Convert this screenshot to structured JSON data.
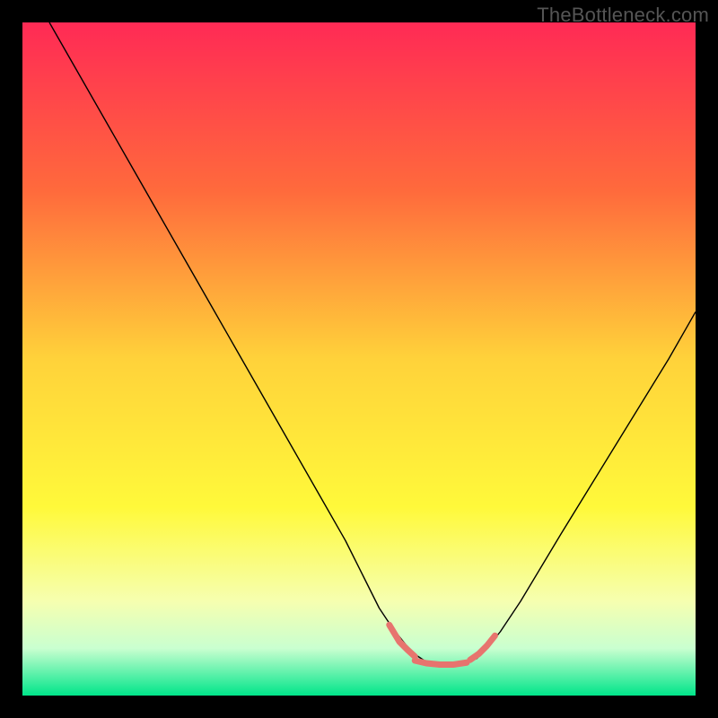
{
  "watermark": "TheBottleneck.com",
  "chart_data": {
    "type": "line",
    "title": "",
    "xlabel": "",
    "ylabel": "",
    "xlim": [
      0,
      100
    ],
    "ylim": [
      0,
      100
    ],
    "grid": false,
    "legend": false,
    "background_gradient": {
      "stops": [
        {
          "offset": 0.0,
          "color": "#ff2a55"
        },
        {
          "offset": 0.25,
          "color": "#ff6a3c"
        },
        {
          "offset": 0.5,
          "color": "#ffd23a"
        },
        {
          "offset": 0.72,
          "color": "#fff93a"
        },
        {
          "offset": 0.86,
          "color": "#f6ffb0"
        },
        {
          "offset": 0.93,
          "color": "#c9ffd0"
        },
        {
          "offset": 1.0,
          "color": "#00e58a"
        }
      ]
    },
    "series": [
      {
        "name": "curve",
        "stroke": "#000000",
        "stroke_width": 1.4,
        "x": [
          4.0,
          8.0,
          12.0,
          16.0,
          20.0,
          24.0,
          28.0,
          32.0,
          36.0,
          40.0,
          44.0,
          48.0,
          51.0,
          53.0,
          55.0,
          57.0,
          58.5,
          60.0,
          62.0,
          64.0,
          66.0,
          67.5,
          69.0,
          71.0,
          74.0,
          77.0,
          80.0,
          84.0,
          88.0,
          92.0,
          96.0,
          100.0
        ],
        "y": [
          100.0,
          93.0,
          86.0,
          79.0,
          72.0,
          65.0,
          58.0,
          51.0,
          44.0,
          37.0,
          30.0,
          23.0,
          17.0,
          13.0,
          10.0,
          7.5,
          6.0,
          5.0,
          4.5,
          4.5,
          5.0,
          5.5,
          7.0,
          9.5,
          14.0,
          19.0,
          24.0,
          30.5,
          37.0,
          43.5,
          50.0,
          57.0
        ]
      },
      {
        "name": "highlight-left",
        "stroke": "#e7746e",
        "stroke_width": 7,
        "linecap": "round",
        "x": [
          54.5,
          56.0,
          57.2,
          58.3
        ],
        "y": [
          10.5,
          8.0,
          6.8,
          5.8
        ]
      },
      {
        "name": "highlight-bottom",
        "stroke": "#e7746e",
        "stroke_width": 7,
        "linecap": "round",
        "x": [
          58.3,
          60.0,
          62.0,
          64.0,
          66.0
        ],
        "y": [
          5.2,
          4.8,
          4.6,
          4.6,
          4.9
        ]
      },
      {
        "name": "highlight-right",
        "stroke": "#e7746e",
        "stroke_width": 7,
        "linecap": "round",
        "x": [
          66.5,
          67.8,
          69.0,
          70.2
        ],
        "y": [
          5.3,
          6.2,
          7.4,
          8.9
        ]
      }
    ]
  }
}
